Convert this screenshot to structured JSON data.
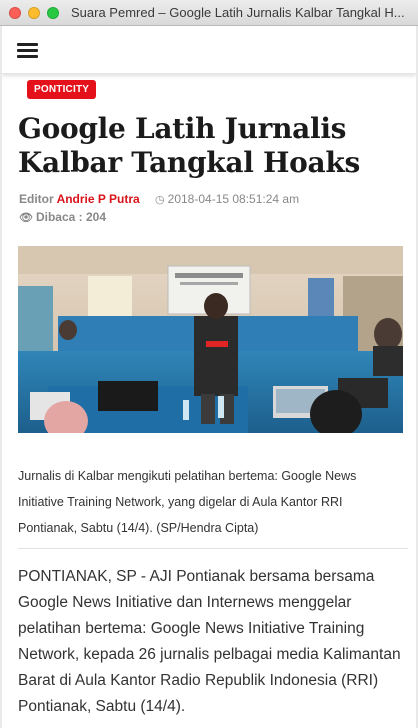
{
  "window": {
    "title": "Suara Pemred – Google Latih Jurnalis Kalbar Tangkal H..."
  },
  "nav": {
    "menu_icon": "hamburger-menu-icon"
  },
  "article": {
    "category": "PONTICITY",
    "headline": "Google Latih Jurnalis Kalbar Tangkal Hoaks",
    "editor_label": "Editor",
    "editor_name": "Andrie P Putra",
    "datetime": "2018-04-15 08:51:24 am",
    "views": "Dibaca : 204",
    "caption_lines": [
      "Jurnalis di Kalbar mengikuti pelatihan bertema: Google News",
      "Initiative Training Network, yang digelar di Aula Kantor RRI",
      "Pontianak, Sabtu (14/4). (SP/Hendra Cipta)"
    ],
    "body_lines": [
      "PONTIANAK, SP - AJI Pontianak bersama bersama",
      "Google News Initiative dan Internews menggelar",
      "pelatihan bertema: Google News Initiative Training",
      "Network, kepada 26 jurnalis pelbagai media Kalimantan",
      "Barat di Aula Kantor Radio Republik Indonesia (RRI)",
      "Pontianak, Sabtu (14/4)."
    ]
  },
  "colors": {
    "accent": "#e4111b",
    "editor_name": "#d9141b",
    "meta_gray": "#888888"
  }
}
